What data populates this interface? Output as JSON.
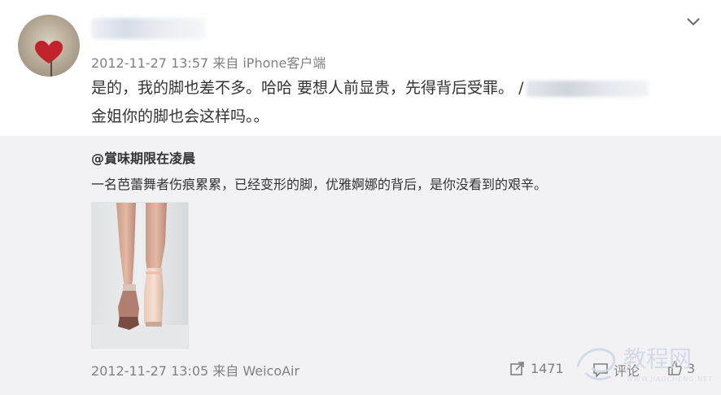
{
  "post": {
    "meta": "2012-11-27 13:57 来自 iPhone客户端",
    "text_line1": "是的，我的脚也差不多。哈哈 要想人前显贵，先得背后受罪。 /",
    "text_line2": "金姐你的脚也会这样吗。。"
  },
  "repost": {
    "author": "@賞味期限在凌晨",
    "text": "一名芭蕾舞者伤痕累累，已经变形的脚，优雅婀娜的背后，是你没看到的艰辛。",
    "meta": "2012-11-27 13:05 来自 WeicoAir",
    "actions": {
      "share_count": "1471",
      "comment_label": "评论",
      "like_count": "3"
    }
  },
  "watermark": {
    "text": "教程网",
    "subtext": "WWW.JIAOCHENG.NET"
  },
  "icons": {
    "chevron": "chevron-down-icon",
    "share": "share-icon",
    "comment": "comment-icon",
    "like": "like-icon"
  }
}
